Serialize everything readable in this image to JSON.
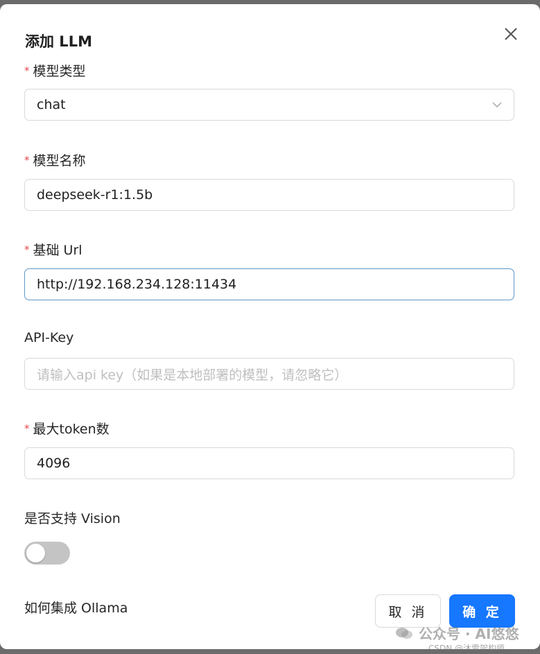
{
  "dialog": {
    "title": "添加 LLM",
    "required_mark": "*",
    "fields": {
      "model_type": {
        "label": "模型类型",
        "value": "chat"
      },
      "model_name": {
        "label": "模型名称",
        "value": "deepseek-r1:1.5b"
      },
      "base_url": {
        "label": "基础 Url",
        "value": "http://192.168.234.128:11434"
      },
      "api_key": {
        "label": "API-Key",
        "value": "",
        "placeholder": "请输入api key（如果是本地部署的模型，请忽略它）"
      },
      "max_tokens": {
        "label": "最大token数",
        "value": "4096"
      },
      "vision": {
        "label": "是否支持 Vision",
        "enabled": false
      }
    },
    "help_link": "如何集成 Ollama",
    "buttons": {
      "cancel": "取 消",
      "ok": "确 定"
    }
  },
  "watermark": {
    "line1": "公众号 · AI悠悠",
    "line2": "CSDN @沐雪架构师"
  },
  "colors": {
    "primary": "#1677ff",
    "required": "#e5484d",
    "focus_border": "#5d97c9"
  },
  "icons": {
    "close": "close-icon",
    "dropdown": "chevron-down-icon",
    "wechat": "wechat-icon"
  }
}
